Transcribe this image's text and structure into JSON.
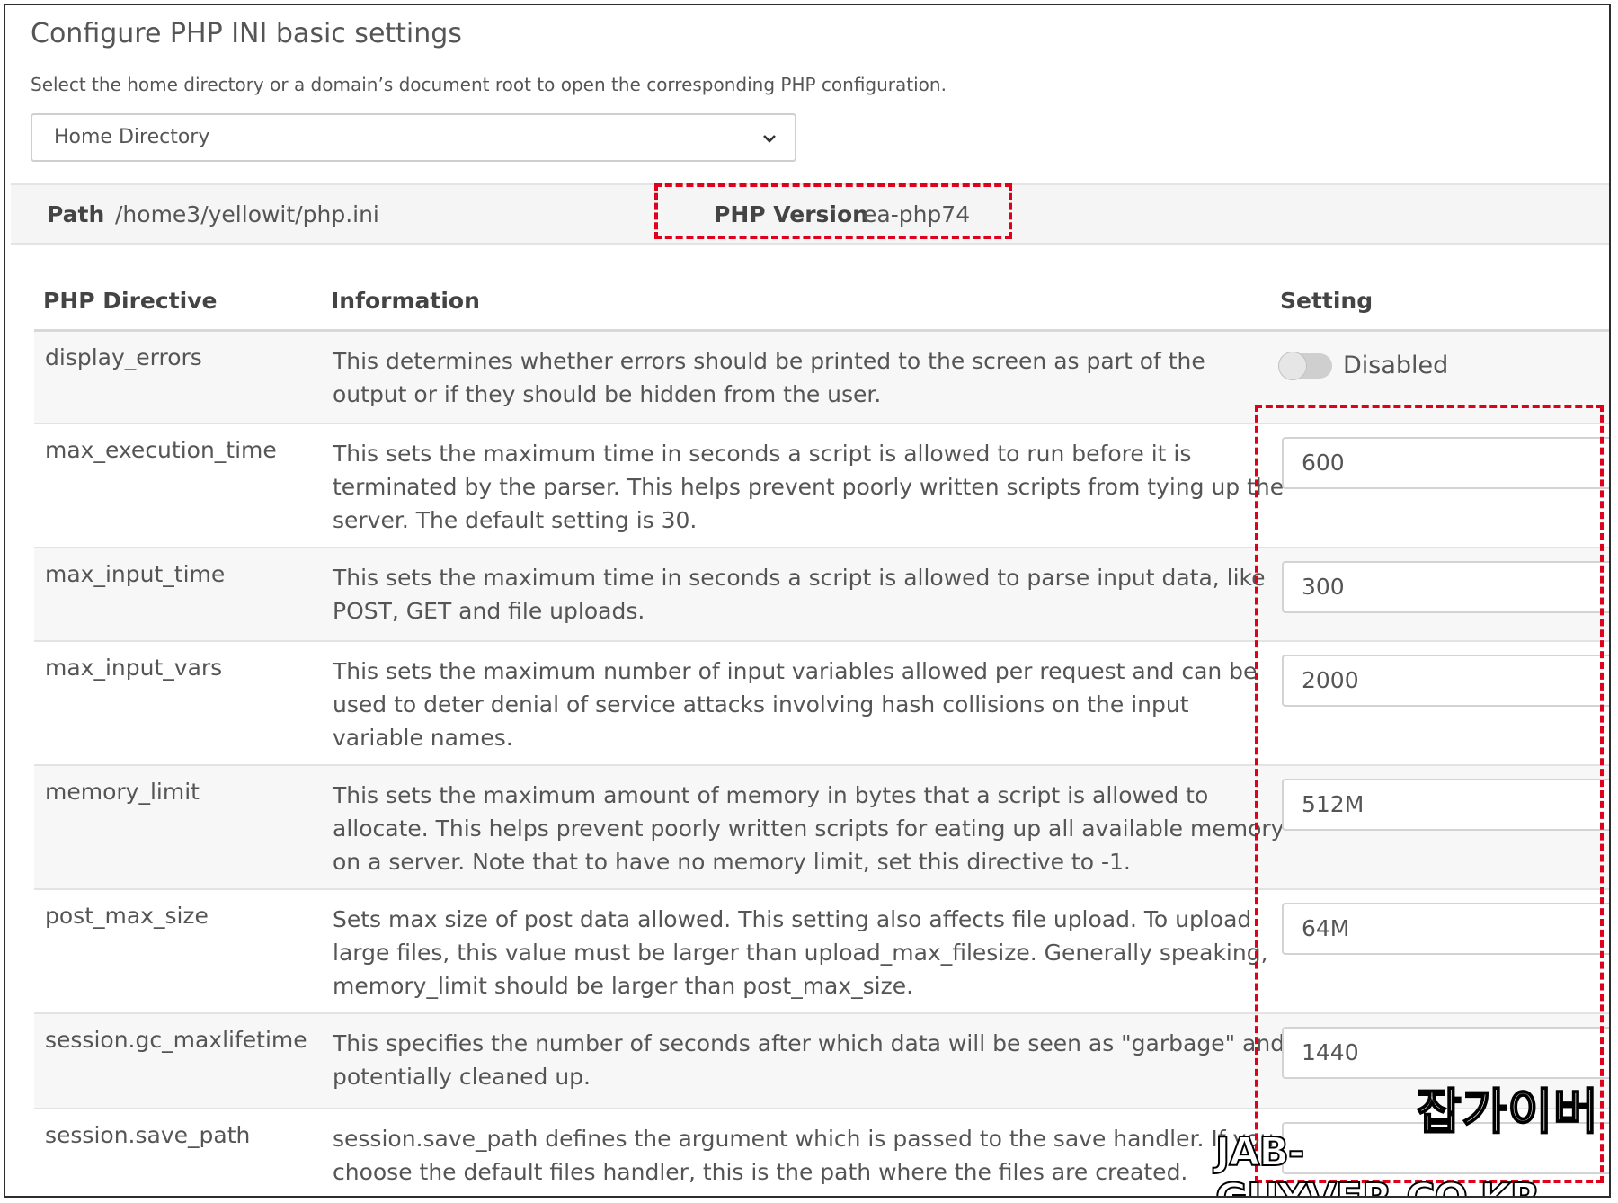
{
  "panel": {
    "title": "Configure PHP INI basic settings",
    "subtitle": "Select the home directory or a domain’s document root to open the corresponding PHP configuration.",
    "location_select": {
      "value": "Home Directory"
    }
  },
  "pathbar": {
    "path_label": "Path",
    "path_value": "/home3/yellowit/php.ini",
    "version_label": "PHP Version",
    "version_value": "ea-php74"
  },
  "table": {
    "headers": [
      "PHP Directive",
      "Information",
      "Setting"
    ],
    "rows": [
      {
        "directive": "display_errors",
        "info": "This determines whether errors should be printed to the screen as part of the output or if they should be hidden from the user.",
        "toggle_label": "Disabled",
        "toggle_on": false
      },
      {
        "directive": "max_execution_time",
        "info": "This sets the maximum time in seconds a script is allowed to run before it is terminated by the parser. This helps prevent poorly written scripts from tying up the server. The default setting is 30.",
        "value": "600"
      },
      {
        "directive": "max_input_time",
        "info": "This sets the maximum time in seconds a script is allowed to parse input data, like POST, GET and file uploads.",
        "value": "300"
      },
      {
        "directive": "max_input_vars",
        "info": "This sets the maximum number of input variables allowed per request and can be used to deter denial of service attacks involving hash collisions on the input variable names.",
        "value": "2000"
      },
      {
        "directive": "memory_limit",
        "info": "This sets the maximum amount of memory in bytes that a script is allowed to allocate. This helps prevent poorly written scripts for eating up all available memory on a server. Note that to have no memory limit, set this directive to -1.",
        "value": "512M"
      },
      {
        "directive": "post_max_size",
        "info": "Sets max size of post data allowed. This setting also affects file upload. To upload large files, this value must be larger than upload_max_filesize. Generally speaking, memory_limit should be larger than post_max_size.",
        "value": "64M"
      },
      {
        "directive": "session.gc_maxlifetime",
        "info": "This specifies the number of seconds after which data will be seen as \"garbage\" and potentially cleaned up.",
        "value": "1440"
      },
      {
        "directive": "session.save_path",
        "info": "session.save_path defines the argument which is passed to the save handler. If you choose the default files handler, this is the path where the files are created.",
        "value": ""
      }
    ]
  },
  "watermark": {
    "line1": "잡가이버",
    "line2": "JAB-GUYVER.CO.KR"
  },
  "colors": {
    "highlight": "#e0001b",
    "row_shade": "#f7f7f7"
  }
}
